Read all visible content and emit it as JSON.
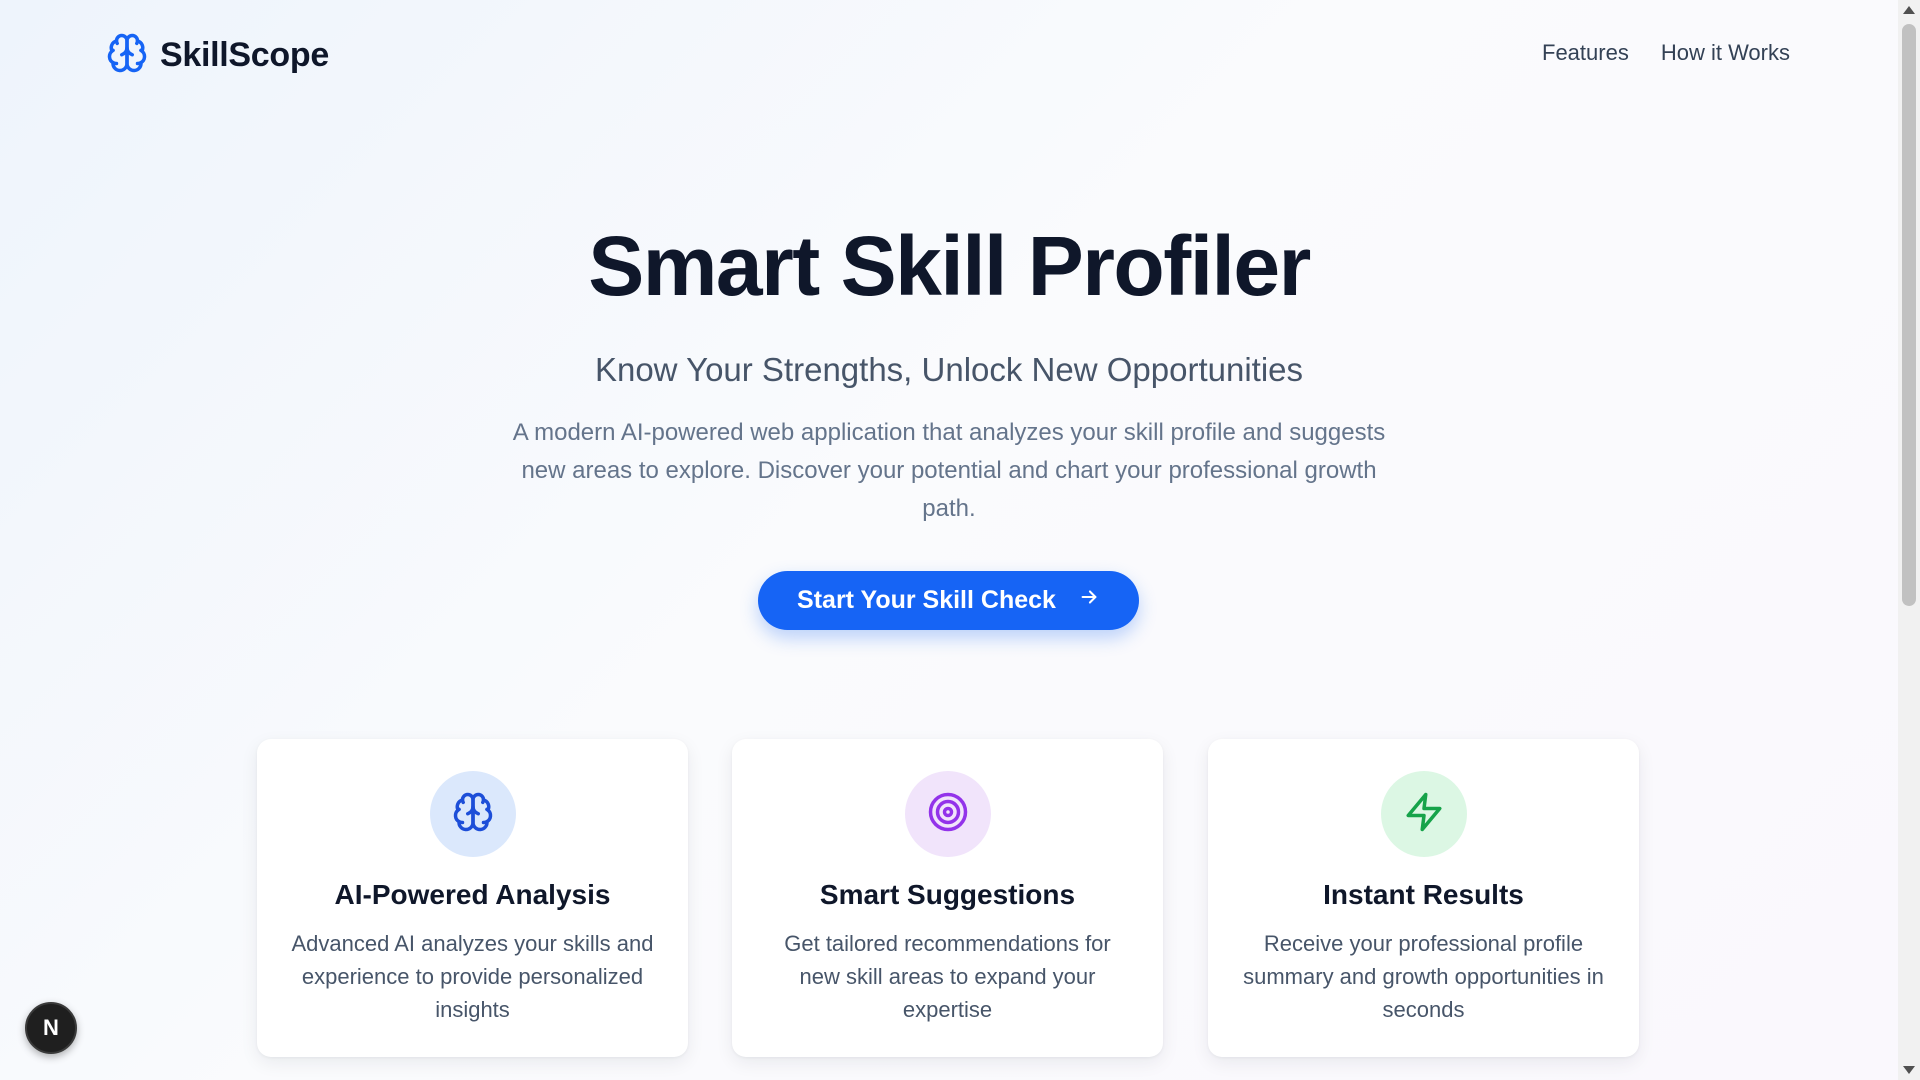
{
  "brand": {
    "name": "SkillScope",
    "icon": "brain-icon",
    "accent": "#1664f5"
  },
  "nav": {
    "items": [
      "Features",
      "How it Works"
    ]
  },
  "hero": {
    "title": "Smart Skill Profiler",
    "subtitle": "Know Your Strengths, Unlock New Opportunities",
    "description": "A modern AI-powered web application that analyzes your skill profile and suggests new areas to explore. Discover your potential and chart your professional growth path.",
    "cta_label": "Start Your Skill Check",
    "cta_icon": "arrow-right-icon"
  },
  "features": [
    {
      "icon": "brain-icon",
      "icon_color": "#1d4ed8",
      "bg_color": "#dbe8fc",
      "title": "AI-Powered Analysis",
      "description": "Advanced AI analyzes your skills and experience to provide personalized insights"
    },
    {
      "icon": "target-icon",
      "icon_color": "#9333ea",
      "bg_color": "#f1e4fb",
      "title": "Smart Suggestions",
      "description": "Get tailored recommendations for new skill areas to expand your expertise"
    },
    {
      "icon": "lightning-icon",
      "icon_color": "#16a34a",
      "bg_color": "#dcf7e4",
      "title": "Instant Results",
      "description": "Receive your professional profile summary and growth opportunities in seconds"
    }
  ],
  "badge": {
    "label": "N"
  }
}
